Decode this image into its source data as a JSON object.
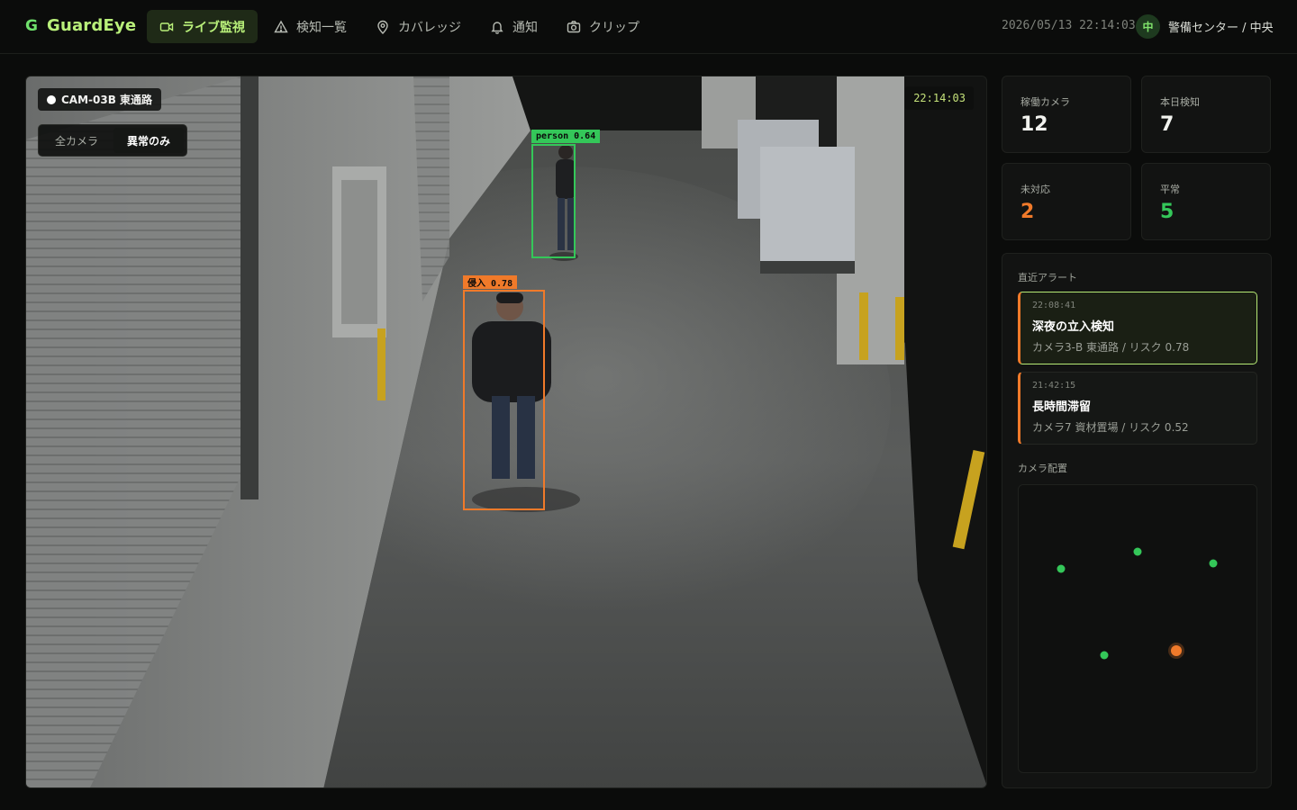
{
  "app": {
    "logo_mark": "G",
    "name": "GuardEye"
  },
  "nav": [
    {
      "label": "ライブ監視",
      "icon": "video-icon",
      "active": true
    },
    {
      "label": "検知一覧",
      "icon": "warning-icon",
      "active": false
    },
    {
      "label": "カバレッジ",
      "icon": "location-pin-icon",
      "active": false
    },
    {
      "label": "通知",
      "icon": "bell-icon",
      "active": false
    },
    {
      "label": "クリップ",
      "icon": "camera-icon",
      "active": false
    }
  ],
  "header": {
    "datetime": "2026/05/13 22:14:03",
    "avatar_initial": "中",
    "user_label": "警備センター / 中央"
  },
  "feed": {
    "camera_label": "CAM-03B 東通路",
    "filter": {
      "all_label": "全カメラ",
      "anomaly_label": "異常のみ",
      "selected": "anomaly"
    },
    "timestamp": "22:14:03",
    "detections": [
      {
        "tag": "person 0.64",
        "color": "#34c759"
      },
      {
        "tag": "侵入 0.78",
        "color": "#f07a2a"
      }
    ]
  },
  "stats": [
    {
      "label": "稼働カメラ",
      "value": "12",
      "color": "#f2f3ef"
    },
    {
      "label": "本日検知",
      "value": "7",
      "color": "#f2f3ef"
    },
    {
      "label": "未対応",
      "value": "2",
      "color": "#f07a2a"
    },
    {
      "label": "平常",
      "value": "5",
      "color": "#34c759"
    }
  ],
  "alerts_section": {
    "title": "直近アラート",
    "items": [
      {
        "time": "22:08:41",
        "title": "深夜の立入検知",
        "meta": "カメラ3-B 東通路 / リスク 0.78"
      },
      {
        "time": "21:42:15",
        "title": "長時間滞留",
        "meta": "カメラ7 資材置場 / リスク 0.52"
      }
    ]
  },
  "map_section": {
    "title": "カメラ配置"
  },
  "colors": {
    "accent": "#b9f07a",
    "ok": "#34c759",
    "alert": "#f07a2a"
  }
}
